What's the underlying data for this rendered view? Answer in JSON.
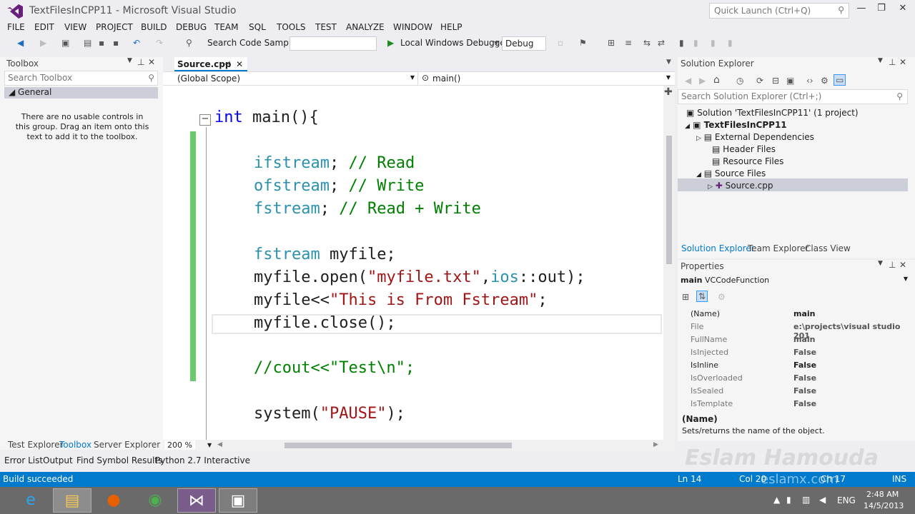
{
  "window": {
    "title": "TextFilesInCPP11 - Microsoft Visual Studio",
    "quick_launch": "Quick Launch (Ctrl+Q)"
  },
  "menu": [
    "FILE",
    "EDIT",
    "VIEW",
    "PROJECT",
    "BUILD",
    "DEBUG",
    "TEAM",
    "SQL",
    "TOOLS",
    "TEST",
    "ANALYZE",
    "WINDOW",
    "HELP"
  ],
  "toolbar": {
    "search_samples": "Search Code Samples:",
    "debugger": "Local Windows Debugger",
    "config": "Debug"
  },
  "toolbox": {
    "title": "Toolbox",
    "search": "Search Toolbox",
    "group": "General",
    "empty": "There are no usable controls in this group. Drag an item onto this text to add it to the toolbox."
  },
  "editor": {
    "tab": "Source.cpp",
    "scope": "(Global Scope)",
    "member": "main()",
    "zoom": "200 %",
    "code": {
      "l1a": "int",
      "l1b": " main(){",
      "l2a": "ifstream",
      "l2b": "; ",
      "l2c": "// Read",
      "l3a": "ofstream",
      "l3b": "; ",
      "l3c": "// Write",
      "l4a": "fstream",
      "l4b": "; ",
      "l4c": "// Read + Write",
      "l5a": "fstream",
      "l5b": " myfile;",
      "l6a": "myfile.open(",
      "l6b": "\"myfile.txt\"",
      "l6c": ",",
      "l6d": "ios",
      "l6e": "::out);",
      "l7a": "myfile<<",
      "l7b": "\"This is From Fstream\"",
      "l7c": ";",
      "l8": "myfile.close();",
      "l9": "//cout<<\"Test\\n\";",
      "l10a": "system(",
      "l10b": "\"PAUSE\"",
      "l10c": ");"
    }
  },
  "solution": {
    "title": "Solution Explorer",
    "search": "Search Solution Explorer (Ctrl+;)",
    "items": [
      "Solution 'TextFilesInCPP11' (1 project)",
      "TextFilesInCPP11",
      "External Dependencies",
      "Header Files",
      "Resource Files",
      "Source Files",
      "Source.cpp"
    ],
    "tabs": [
      "Solution Explorer",
      "Team Explorer",
      "Class View"
    ]
  },
  "properties": {
    "title": "Properties",
    "object": "main",
    "object_type": "VCCodeFunction",
    "rows": [
      {
        "name": "(Name)",
        "value": "main"
      },
      {
        "name": "File",
        "value": "e:\\projects\\visual studio 201"
      },
      {
        "name": "FullName",
        "value": "main"
      },
      {
        "name": "IsInjected",
        "value": "False"
      },
      {
        "name": "IsInline",
        "value": "False"
      },
      {
        "name": "IsOverloaded",
        "value": "False"
      },
      {
        "name": "IsSealed",
        "value": "False"
      },
      {
        "name": "IsTemplate",
        "value": "False"
      }
    ],
    "desc_title": "(Name)",
    "desc": "Sets/returns the name of the object."
  },
  "left_tabs": [
    "Test Explorer",
    "Toolbox",
    "Server Explorer"
  ],
  "bottom_tabs": [
    "Error List",
    "Output",
    "Find Symbol Results",
    "Python 2.7 Interactive"
  ],
  "status": {
    "msg": "Build succeeded",
    "ln": "Ln 14",
    "col": "Col 20",
    "ch": "Ch 17",
    "ins": "INS"
  },
  "watermark": {
    "name": "Eslam Hamouda",
    "site": "eslamx.com"
  },
  "taskbar": {
    "lang": "ENG",
    "time": "2:48 AM",
    "date": "14/5/2013"
  },
  "colors": {
    "accent": "#007acc",
    "changed_bar": "#6cca6c",
    "keyword": "#0000ff",
    "type": "#2b91af",
    "comment": "#008000",
    "string": "#a31515"
  }
}
